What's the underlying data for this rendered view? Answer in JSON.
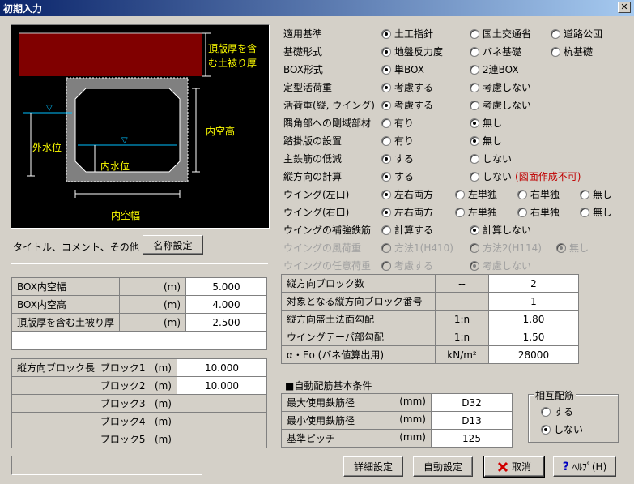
{
  "window": {
    "title": "初期入力",
    "close_glyph": "✕"
  },
  "diagram": {
    "top_label_1": "頂版厚を含",
    "top_label_2": "む土被り厚",
    "inner_height": "内空高",
    "outer_water": "外水位",
    "inner_water": "内水位",
    "inner_width": "内空幅",
    "water_glyph": "▽"
  },
  "title_row": {
    "label": "タイトル、コメント、その他 ：",
    "button": "名称設定"
  },
  "dims": [
    {
      "label": "BOX内空幅",
      "unit": "(m)",
      "value": "5.000"
    },
    {
      "label": "BOX内空高",
      "unit": "(m)",
      "value": "4.000"
    },
    {
      "label": "頂版厚を含む土被り厚",
      "unit": "(m)",
      "value": "2.500"
    }
  ],
  "blocks": {
    "head": "縦方向ブロック長",
    "rows": [
      {
        "label": "ブロック1",
        "unit": "(m)",
        "value": "10.000"
      },
      {
        "label": "ブロック2",
        "unit": "(m)",
        "value": "10.000"
      },
      {
        "label": "ブロック3",
        "unit": "(m)",
        "value": ""
      },
      {
        "label": "ブロック4",
        "unit": "(m)",
        "value": ""
      },
      {
        "label": "ブロック5",
        "unit": "(m)",
        "value": ""
      }
    ]
  },
  "options": [
    {
      "label": "適用基準",
      "opts": [
        "土工指針",
        "国土交通省",
        "道路公団"
      ],
      "sel": 0
    },
    {
      "label": "基礎形式",
      "opts": [
        "地盤反力度",
        "バネ基礎",
        "杭基礎"
      ],
      "sel": 0
    },
    {
      "label": "BOX形式",
      "opts": [
        "単BOX",
        "2連BOX"
      ],
      "sel": 0
    },
    {
      "label": "定型活荷重",
      "opts": [
        "考慮する",
        "考慮しない"
      ],
      "sel": 0
    },
    {
      "label": "活荷重(縦, ウイング)",
      "opts": [
        "考慮する",
        "考慮しない"
      ],
      "sel": 0
    },
    {
      "label": "隅角部への剛域部材",
      "opts": [
        "有り",
        "無し"
      ],
      "sel": 1
    },
    {
      "label": "踏掛版の設置",
      "opts": [
        "有り",
        "無し"
      ],
      "sel": 1
    },
    {
      "label": "主鉄筋の低減",
      "opts": [
        "する",
        "しない"
      ],
      "sel": 0
    },
    {
      "label": "縦方向の計算",
      "opts": [
        "する",
        "しない"
      ],
      "sel": 0,
      "note": "(図面作成不可)"
    },
    {
      "label": "ウイング(左口)",
      "opts": [
        "左右両方",
        "左単独",
        "右単独",
        "無し"
      ],
      "sel": 0
    },
    {
      "label": "ウイング(右口)",
      "opts": [
        "左右両方",
        "左単独",
        "右単独",
        "無し"
      ],
      "sel": 0
    },
    {
      "label": "ウイングの補強鉄筋",
      "opts": [
        "計算する",
        "計算しない"
      ],
      "sel": 1
    },
    {
      "label": "ウイングの風荷重",
      "opts": [
        "方法1(H410)",
        "方法2(H114)",
        "無し"
      ],
      "sel": 2,
      "disabled": true
    },
    {
      "label": "ウイングの任意荷重",
      "opts": [
        "考慮する",
        "考慮しない"
      ],
      "sel": 1,
      "disabled": true
    }
  ],
  "long_table": [
    {
      "label": "縦方向ブロック数",
      "unit": "--",
      "value": "2"
    },
    {
      "label": "対象となる縦方向ブロック番号",
      "unit": "--",
      "value": "1"
    },
    {
      "label": "縦方向盛土法面勾配",
      "unit": "1:n",
      "value": "1.80"
    },
    {
      "label": "ウイングテーパ部勾配",
      "unit": "1:n",
      "value": "1.50"
    },
    {
      "label": "α・Eo (バネ値算出用)",
      "unit": "kN/m²",
      "value": "28000"
    }
  ],
  "auto_rebar": {
    "title": "■自動配筋基本条件",
    "rows": [
      {
        "label": "最大使用鉄筋径",
        "unit": "(mm)",
        "value": "D32"
      },
      {
        "label": "最小使用鉄筋径",
        "unit": "(mm)",
        "value": "D13"
      },
      {
        "label": "基準ピッチ",
        "unit": "(mm)",
        "value": "125"
      }
    ]
  },
  "mutual": {
    "title": "相互配筋",
    "opts": [
      "する",
      "しない"
    ],
    "sel": 1
  },
  "buttons": {
    "detail": "詳細設定",
    "auto": "自動設定",
    "cancel": "取消",
    "help": "ﾍﾙﾌﾟ(H)"
  }
}
